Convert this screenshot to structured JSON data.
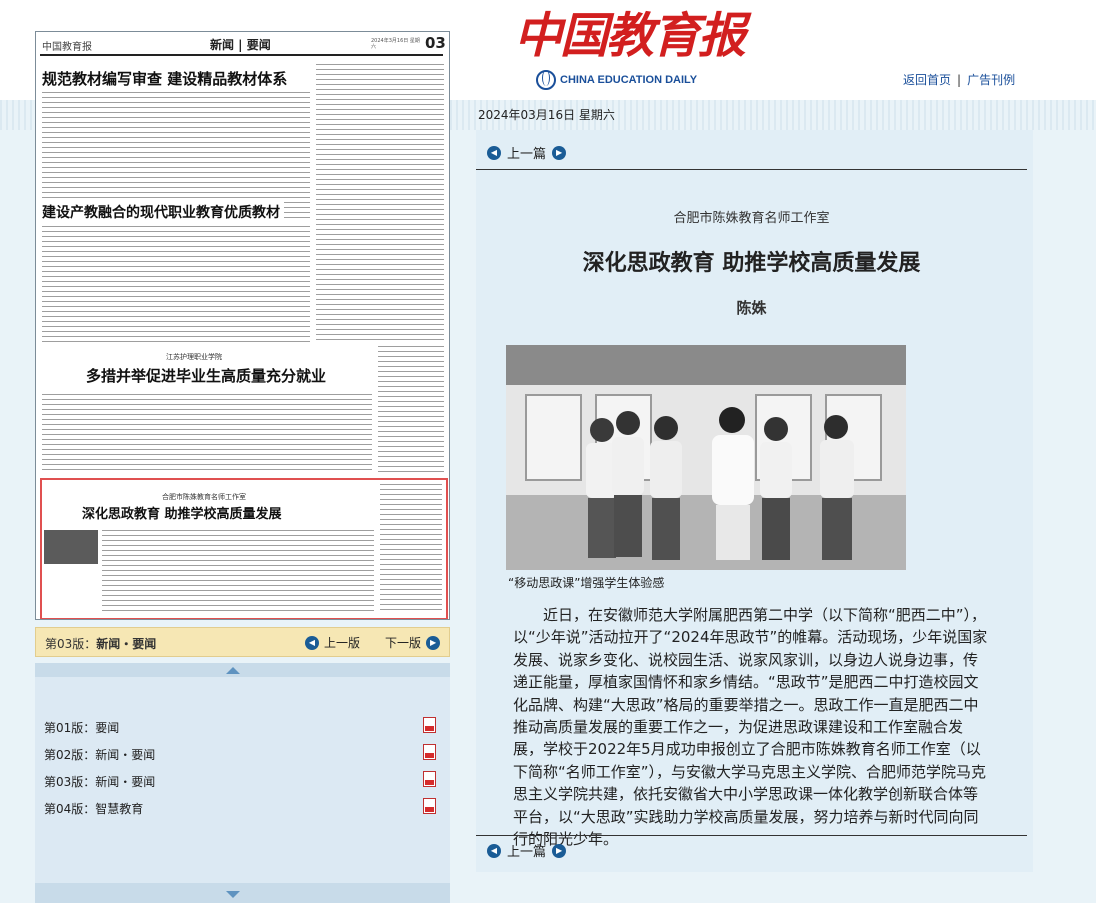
{
  "header": {
    "logo_cn": "中国教育报",
    "logo_en": "CHINA EDUCATION DAILY",
    "nav": [
      "返回首页",
      "广告刊例"
    ]
  },
  "issue": {
    "date": "2024年03月16日  星期六"
  },
  "page_preview": {
    "masthead": "中国教育报",
    "section": "新闻 | 要闻",
    "page_no": "03",
    "date_small": "2024年3月16日 星期六",
    "headlines": [
      "规范教材编写审查  建设精品教材体系",
      "建设产教融合的现代职业教育优质教材",
      "多措并举促进毕业生高质量充分就业",
      "深化思政教育  助推学校高质量发展"
    ],
    "subheads": [
      "江苏护理职业学院",
      "合肥市陈姝教育名师工作室"
    ]
  },
  "current_page": {
    "label": "第03版：",
    "name": "新闻・要闻",
    "prev": "上一版",
    "next": "下一版"
  },
  "pages": [
    {
      "label": "第01版：要闻"
    },
    {
      "label": "第02版：新闻・要闻"
    },
    {
      "label": "第03版：新闻・要闻"
    },
    {
      "label": "第04版：智慧教育"
    }
  ],
  "article": {
    "prev_label": "上一篇",
    "kicker": "合肥市陈姝教育名师工作室",
    "title": "深化思政教育  助推学校高质量发展",
    "author": "陈姝",
    "caption": "“移动思政课”增强学生体验感",
    "body": "近日，在安徽师范大学附属肥西第二中学（以下简称“肥西二中”），以“少年说”活动拉开了“2024年思政节”的帷幕。活动现场，少年说国家发展、说家乡变化、说校园生活、说家风家训，以身边人说身边事，传递正能量，厚植家国情怀和家乡情结。“思政节”是肥西二中打造校园文化品牌、构建“大思政”格局的重要举措之一。思政工作一直是肥西二中推动高质量发展的重要工作之一，为促进思政课建设和工作室融合发展，学校于2022年5月成功申报创立了合肥市陈姝教育名师工作室（以下简称“名师工作室”），与安徽大学马克思主义学院、合肥师范学院马克思主义学院共建，依托安徽省大中小学思政课一体化教学创新联合体等平台，以“大思政”实践助力学校高质量发展，努力培养与新时代同向同行的阳光少年。"
  },
  "colors": {
    "logo_red": "#d21f1f",
    "link_blue": "#1a4f9a",
    "panel_bg": "#e1eef6",
    "highlight_box": "#e05050"
  }
}
